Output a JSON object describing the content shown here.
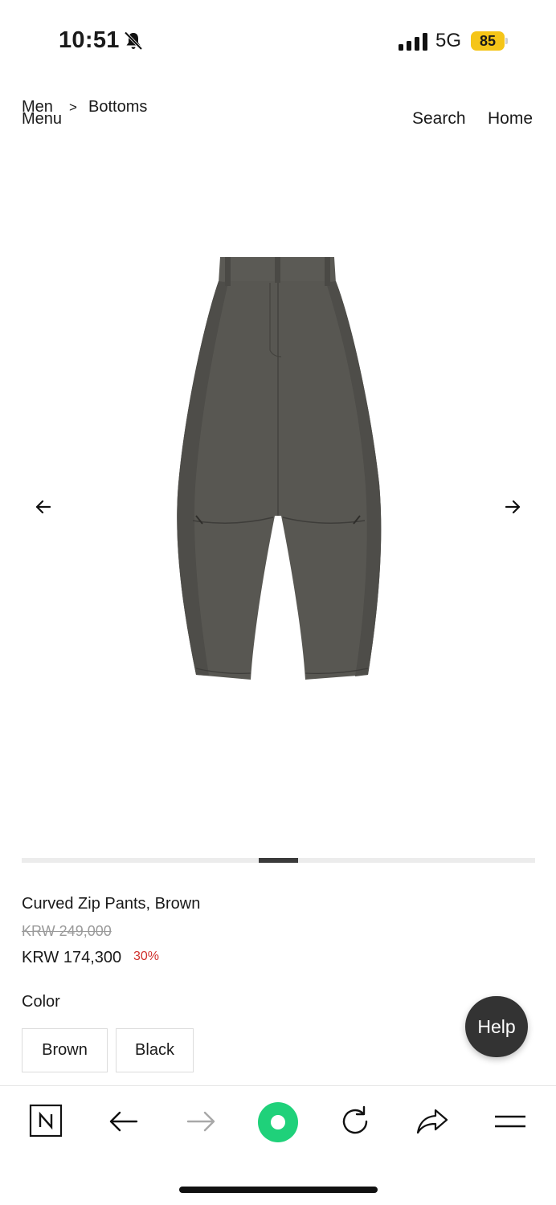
{
  "status_bar": {
    "time": "10:51",
    "network": "5G",
    "battery": "85"
  },
  "header": {
    "breadcrumb_root": "Men",
    "menu_label": "Menu",
    "breadcrumb_separator": ">",
    "breadcrumb_category": "Bottoms",
    "search_label": "Search",
    "home_label": "Home"
  },
  "gallery": {
    "image_icon": "pants-product-image",
    "prev_icon": "arrow-left-icon",
    "next_icon": "arrow-right-icon",
    "image_index": 5,
    "image_count": 13
  },
  "product": {
    "name": "Curved Zip Pants, Brown",
    "original_price": "KRW 249,000",
    "price": "KRW 174,300",
    "discount": "30%",
    "color_label": "Color",
    "colors": [
      "Brown",
      "Black"
    ]
  },
  "help_button": {
    "label": "Help"
  },
  "browser_toolbar": {
    "icons": [
      "naver-n-icon",
      "back-arrow-icon",
      "forward-arrow-icon",
      "green-home-icon",
      "reload-icon",
      "share-icon",
      "menu-icon"
    ]
  },
  "colors": {
    "discount": "#d0312d",
    "accent_green": "#1fd17a",
    "battery": "#f5c518"
  }
}
